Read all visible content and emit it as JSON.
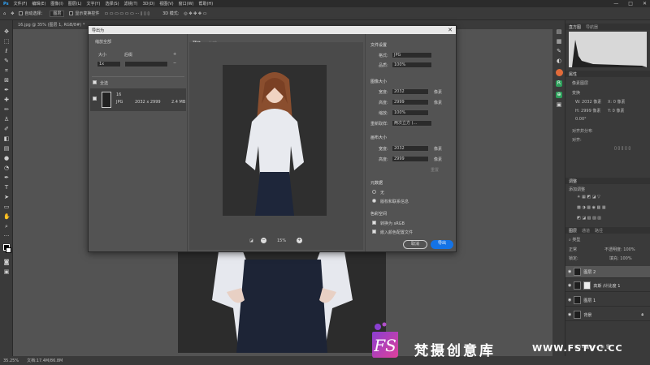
{
  "menubar": {
    "items": [
      "文件(F)",
      "编辑(E)",
      "图像(I)",
      "图层(L)",
      "文字(Y)",
      "选择(S)",
      "滤镜(T)",
      "3D(D)",
      "视图(V)",
      "窗口(W)",
      "帮助(H)"
    ],
    "window_controls": [
      "—",
      "□",
      "✕"
    ]
  },
  "options": {
    "auto_select": "自动选择：",
    "layer_select": "图层",
    "show_transform": "显示变换控件"
  },
  "tab": {
    "title": "16.jpg @ 35% (图层 1, RGB/8#) *"
  },
  "status": {
    "zoom": "35.25%",
    "doc": "文档:17.4M/86.8M"
  },
  "right_panel": {
    "histogram_tab": "直方图",
    "nav_tab": "导航器",
    "properties_title": "属性",
    "properties_tab": "像素图层",
    "transform_label": "变换",
    "w_value": "2032 像素",
    "h_value": "2999 像素",
    "x_value": "0 像素",
    "y_value": "0 像素",
    "angle": "0.00°",
    "align_label": "对齐并分布",
    "align_sub": "对齐:",
    "adjust_title": "调整",
    "adjust_sub": "添加调整",
    "layers_tab": "图层",
    "channels_tab": "通道",
    "paths_tab": "路径",
    "kind": "类型",
    "blend": "正常",
    "opacity": "不透明度: 100%",
    "lock": "锁定:",
    "fill": "填充: 100%",
    "layers": [
      "图层 2",
      "高斯 /计比度 1",
      "图层 1",
      "背景"
    ]
  },
  "dialog": {
    "title": "导出为",
    "close": "✕",
    "scale_all": "缩放全部",
    "size_label": "大小",
    "suffix_label": "后缀",
    "size_value": "1x",
    "select_all": "全选",
    "file_name": "16",
    "file_type": "JPG",
    "file_dims": "2032 x 2999",
    "file_size": "2.4 MB",
    "tab_preview": "预览",
    "tab_compare": "比较",
    "zoom": "15%",
    "file_settings": "文件设置",
    "format_label": "格式:",
    "format_value": "JPG",
    "quality_label": "品质:",
    "quality_value": "100%",
    "image_size": "图像大小",
    "width_label": "宽度:",
    "width_value": "2032",
    "height_label": "高度:",
    "height_value": "2999",
    "unit_px": "像素",
    "scale_label": "缩放:",
    "scale_value": "100%",
    "resample_label": "重新取样:",
    "resample_value": "两次立方 (...",
    "canvas_size": "画布大小",
    "canvas_width": "2032",
    "canvas_height": "2999",
    "reset": "重置",
    "metadata": "元数据",
    "meta_none": "无",
    "meta_copyright": "版权和联系信息",
    "color_space": "色彩空间",
    "convert_srgb": "转换为 sRGB",
    "embed_profile": "嵌入颜色配置文件",
    "cancel": "取消",
    "export": "导出"
  },
  "watermark": {
    "logo_text": "FS",
    "text": "梵摄创意库",
    "url": "WWW.FSTVC.CC"
  },
  "colors": {
    "accent_blue": "#1473e6",
    "logo_pink": "#e0409a",
    "logo_purple": "#8a3fd1"
  }
}
